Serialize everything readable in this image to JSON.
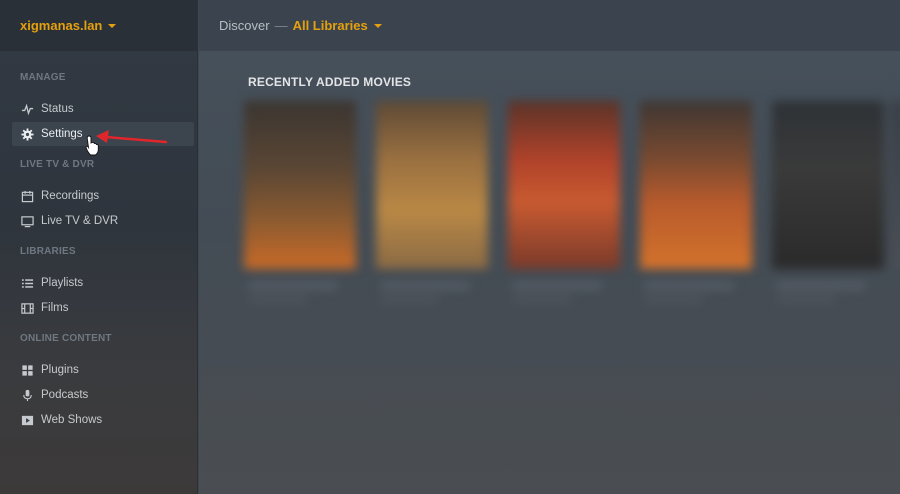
{
  "server": {
    "name": "xigmanas.lan"
  },
  "header": {
    "discover": "Discover",
    "separator": "—",
    "library_selector": "All Libraries"
  },
  "sidebar": {
    "sections": [
      {
        "title": "MANAGE",
        "items": [
          {
            "label": "Status",
            "icon": "activity-icon"
          },
          {
            "label": "Settings",
            "icon": "gear-icon",
            "active": true
          }
        ]
      },
      {
        "title": "LIVE TV & DVR",
        "items": [
          {
            "label": "Recordings",
            "icon": "calendar-icon"
          },
          {
            "label": "Live TV & DVR",
            "icon": "tv-icon"
          }
        ]
      },
      {
        "title": "LIBRARIES",
        "items": [
          {
            "label": "Playlists",
            "icon": "list-icon"
          },
          {
            "label": "Films",
            "icon": "film-icon"
          }
        ]
      },
      {
        "title": "ONLINE CONTENT",
        "items": [
          {
            "label": "Plugins",
            "icon": "grid-icon"
          },
          {
            "label": "Podcasts",
            "icon": "microphone-icon"
          },
          {
            "label": "Web Shows",
            "icon": "play-icon"
          }
        ]
      }
    ]
  },
  "main": {
    "hub_title": "RECENTLY ADDED MOVIES"
  },
  "colors": {
    "accent": "#e5a00d",
    "annotation_arrow": "#e0262b"
  }
}
